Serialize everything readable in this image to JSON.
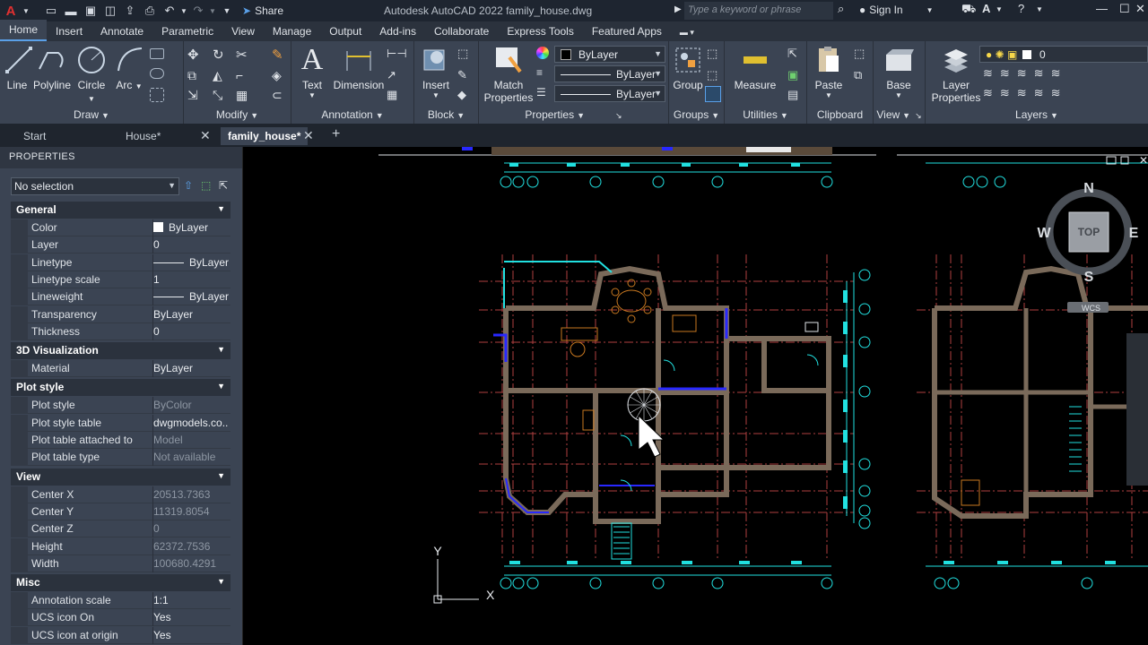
{
  "window": {
    "title": "Autodesk AutoCAD 2022    family_house.dwg",
    "search_placeholder": "Type a keyword or phrase",
    "sign_in": "Sign In",
    "share": "Share"
  },
  "ribbon_tabs": [
    "Home",
    "Insert",
    "Annotate",
    "Parametric",
    "View",
    "Manage",
    "Output",
    "Add-ins",
    "Collaborate",
    "Express Tools",
    "Featured Apps"
  ],
  "ribbon": {
    "draw": {
      "label": "Draw",
      "tools": [
        "Line",
        "Polyline",
        "Circle",
        "Arc"
      ]
    },
    "modify": {
      "label": "Modify"
    },
    "annotation": {
      "label": "Annotation",
      "tools": [
        "Text",
        "Dimension"
      ]
    },
    "block": {
      "label": "Block",
      "insert": "Insert"
    },
    "properties": {
      "label": "Properties",
      "match": "Match Properties",
      "color": "ByLayer",
      "linetype": "ByLayer",
      "lineweight": "ByLayer"
    },
    "groups": {
      "label": "Groups",
      "group": "Group"
    },
    "utilities": {
      "label": "Utilities",
      "measure": "Measure"
    },
    "clipboard": {
      "label": "Clipboard",
      "paste": "Paste"
    },
    "view": {
      "label": "View",
      "base": "Base"
    },
    "layers": {
      "label": "Layers",
      "layer_props": "Layer Properties",
      "current_layer": "0"
    }
  },
  "doc_tabs": [
    {
      "label": "Start"
    },
    {
      "label": "House*"
    },
    {
      "label": "family_house*"
    }
  ],
  "properties": {
    "title": "PROPERTIES",
    "selection": "No selection",
    "sections": {
      "general": {
        "label": "General",
        "rows": [
          {
            "k": "Color",
            "v": "ByLayer"
          },
          {
            "k": "Layer",
            "v": "0"
          },
          {
            "k": "Linetype",
            "v": "ByLayer"
          },
          {
            "k": "Linetype scale",
            "v": "1"
          },
          {
            "k": "Lineweight",
            "v": "ByLayer"
          },
          {
            "k": "Transparency",
            "v": "ByLayer"
          },
          {
            "k": "Thickness",
            "v": "0"
          }
        ]
      },
      "viz": {
        "label": "3D Visualization",
        "rows": [
          {
            "k": "Material",
            "v": "ByLayer"
          }
        ]
      },
      "plot": {
        "label": "Plot style",
        "rows": [
          {
            "k": "Plot style",
            "v": "ByColor"
          },
          {
            "k": "Plot style table",
            "v": "dwgmodels.co..."
          },
          {
            "k": "Plot table attached to",
            "v": "Model"
          },
          {
            "k": "Plot table type",
            "v": "Not available"
          }
        ]
      },
      "view": {
        "label": "View",
        "rows": [
          {
            "k": "Center X",
            "v": "20513.7363"
          },
          {
            "k": "Center Y",
            "v": "11319.8054"
          },
          {
            "k": "Center Z",
            "v": "0"
          },
          {
            "k": "Height",
            "v": "62372.7536"
          },
          {
            "k": "Width",
            "v": "100680.4291"
          }
        ]
      },
      "misc": {
        "label": "Misc",
        "rows": [
          {
            "k": "Annotation scale",
            "v": "1:1"
          },
          {
            "k": "UCS icon On",
            "v": "Yes"
          },
          {
            "k": "UCS icon at origin",
            "v": "Yes"
          }
        ]
      }
    }
  },
  "viewcube": {
    "n": "N",
    "s": "S",
    "e": "E",
    "w": "W",
    "top": "TOP",
    "wcs": "WCS"
  },
  "ucs": {
    "x": "X",
    "y": "Y"
  },
  "colors": {
    "accent": "#5aa0e8",
    "wall": "#7a6a5a",
    "cyan": "#21e0e0",
    "blue": "#2828ff",
    "furniture": "#c87820",
    "dim": "#e0c030"
  }
}
